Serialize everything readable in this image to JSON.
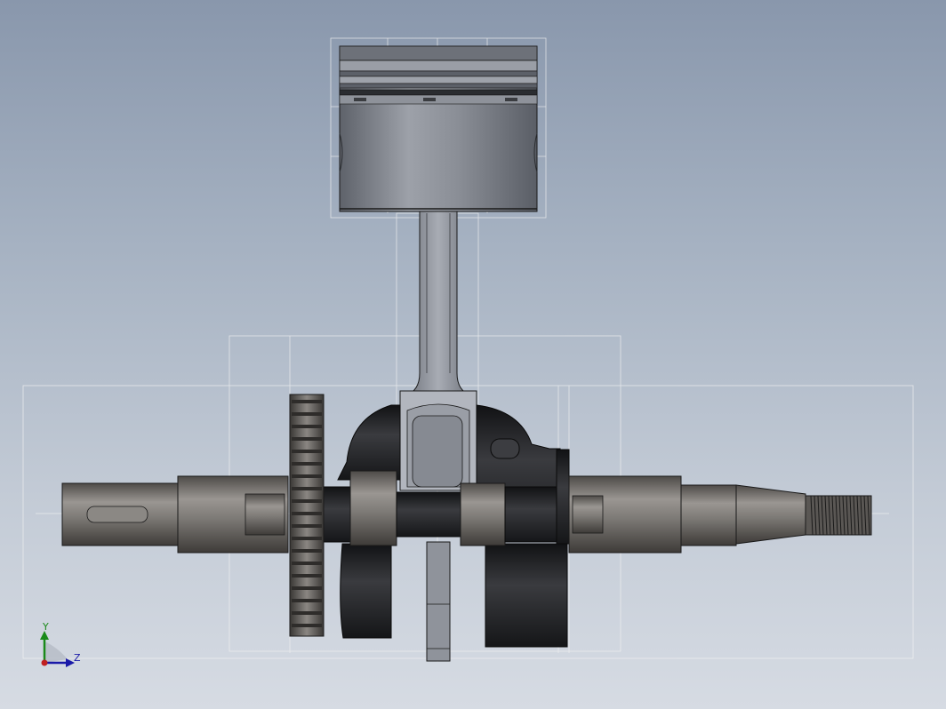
{
  "viewport": {
    "background_top": "#8997ac",
    "background_bottom": "#d6dbe3"
  },
  "model": {
    "parts": [
      "piston",
      "connecting-rod",
      "crankshaft",
      "timing-gear",
      "counterweight-left",
      "counterweight-right",
      "threaded-end"
    ],
    "colors": {
      "piston": "#8a8e96",
      "shaft": "#7d7a76",
      "dark_web": "#222326",
      "outline": "#1a1a1a",
      "bounding_box": "#f2f2f2"
    }
  },
  "triad": {
    "y_label": "Y",
    "z_label": "Z",
    "y_color": "#1a8a1a",
    "z_color": "#1a1aa8",
    "origin_color": "#c02020"
  }
}
